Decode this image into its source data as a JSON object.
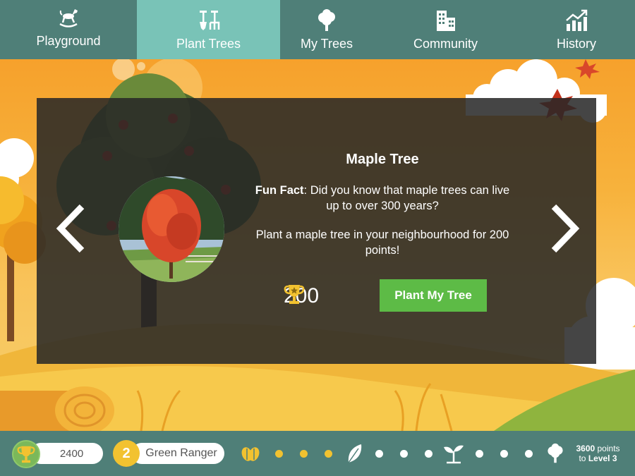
{
  "nav": {
    "items": [
      {
        "label": "Playground",
        "icon": "rocking-horse-icon",
        "active": false
      },
      {
        "label": "Plant Trees",
        "icon": "garden-tools-icon",
        "active": true
      },
      {
        "label": "My Trees",
        "icon": "tree-icon",
        "active": false
      },
      {
        "label": "Community",
        "icon": "buildings-icon",
        "active": false
      },
      {
        "label": "History",
        "icon": "chart-up-icon",
        "active": false
      }
    ]
  },
  "card": {
    "title": "Maple Tree",
    "fact_label": "Fun Fact",
    "fact_text": ": Did you know that maple trees can live up to over 300 years?",
    "plant_message": "Plant a maple tree in your neighbourhood for 200 points!",
    "reward_points": "200",
    "plant_button": "Plant My Tree"
  },
  "footer": {
    "score": "2400",
    "level_number": "2",
    "rank_title": "Green Ranger",
    "progress": {
      "completed_dots": 3,
      "milestones": [
        "seeds-icon",
        "leaf-icon",
        "sprout-icon",
        "tree-icon"
      ]
    },
    "points_to_level_value": "3600",
    "points_to_level_unit": " points",
    "points_to_level_target_prefix": "to ",
    "points_to_level_target": "Level 3"
  },
  "colors": {
    "nav_bg": "#4f7f78",
    "nav_active": "#79c3b7",
    "button_green": "#5dbb46",
    "gold": "#f2c230"
  }
}
